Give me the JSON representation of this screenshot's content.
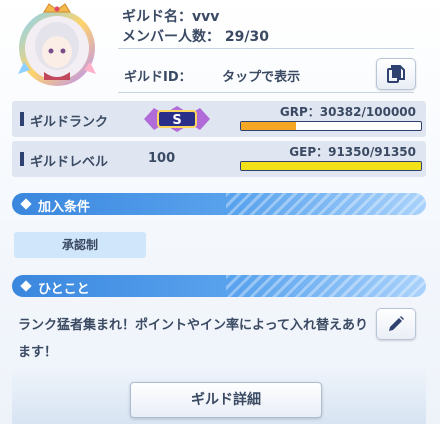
{
  "guild": {
    "name_line": "ギルド名：vvv",
    "members_line": "メンバー人数： 29/30",
    "id_label": "ギルドID：",
    "id_action": "タップで表示",
    "emblem_icon": "guild-emblem-character-icon"
  },
  "rank": {
    "label": "ギルドランク",
    "badge_letter": "S",
    "meter_text": "GRP：30382/100000",
    "progress": 0.304,
    "fill_color": "#f5a623"
  },
  "level": {
    "label": "ギルドレベル",
    "value": "100",
    "meter_text": "GEP：91350/91350",
    "progress": 1.0,
    "fill_color": "#f2e018"
  },
  "join": {
    "title": "加入条件",
    "condition": "承認制"
  },
  "message": {
    "title": "ひとこと",
    "text": "ランク猛者集まれ！ポイントやイン率によって入れ替えあります！"
  },
  "footer": {
    "detail_button": "ギルド詳細"
  },
  "colors": {
    "accent": "#3a87de",
    "navy": "#2f4170"
  }
}
